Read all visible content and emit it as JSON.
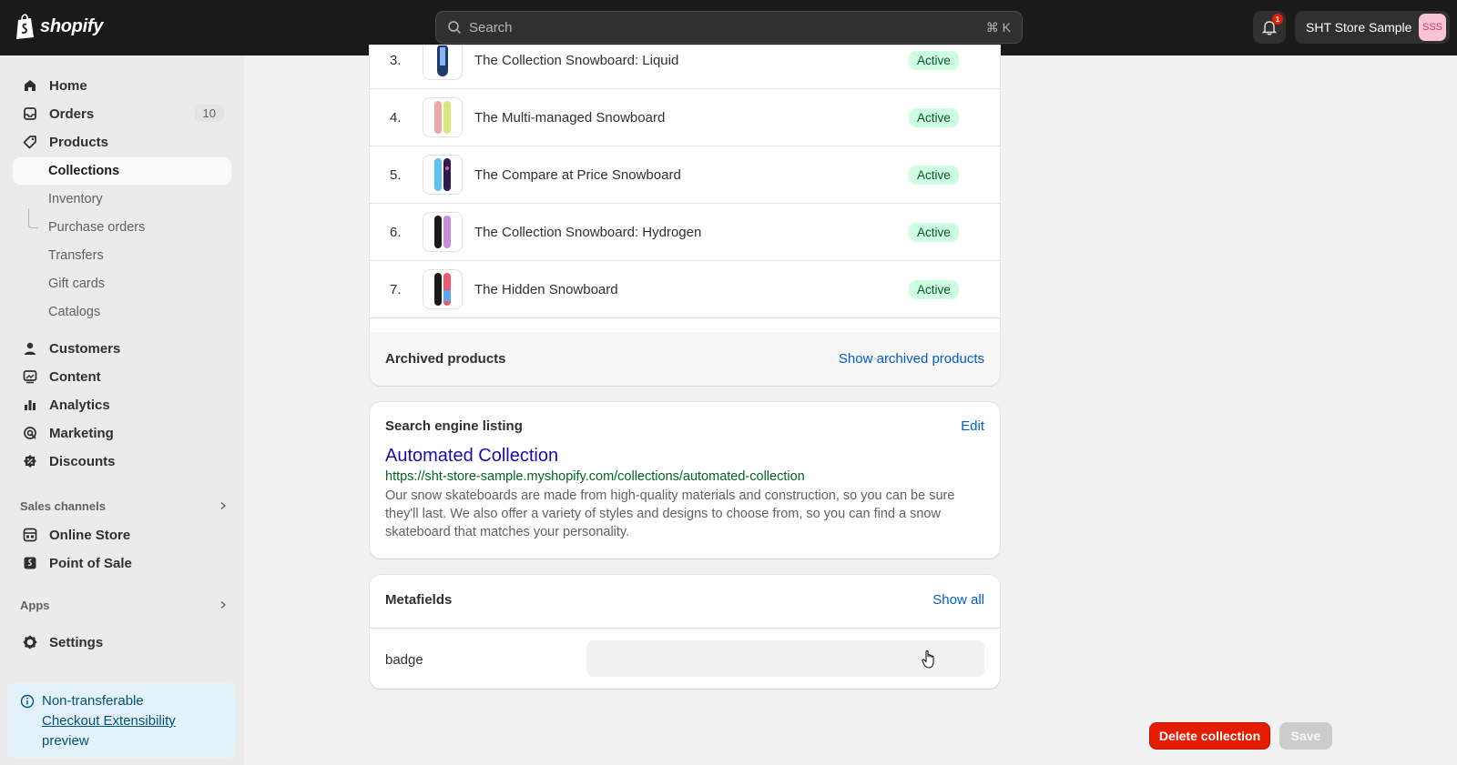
{
  "topbar": {
    "logo_text": "shopify",
    "search_placeholder": "Search",
    "search_shortcut": "⌘ K",
    "notification_count": "1",
    "store_name": "SHT Store Sample",
    "avatar_initials": "SSS"
  },
  "sidebar": {
    "items": [
      {
        "label": "Home",
        "icon": "home-icon"
      },
      {
        "label": "Orders",
        "icon": "inbox-icon",
        "count": "10"
      },
      {
        "label": "Products",
        "icon": "tag-icon"
      },
      {
        "label": "Collections"
      },
      {
        "label": "Inventory"
      },
      {
        "label": "Purchase orders"
      },
      {
        "label": "Transfers"
      },
      {
        "label": "Gift cards"
      },
      {
        "label": "Catalogs"
      },
      {
        "label": "Customers",
        "icon": "person-icon"
      },
      {
        "label": "Content",
        "icon": "content-icon"
      },
      {
        "label": "Analytics",
        "icon": "bar-chart-icon"
      },
      {
        "label": "Marketing",
        "icon": "target-icon"
      },
      {
        "label": "Discounts",
        "icon": "discount-icon"
      },
      {
        "label": "Online Store",
        "icon": "store-icon"
      },
      {
        "label": "Point of Sale",
        "icon": "pos-icon"
      },
      {
        "label": "Settings",
        "icon": "gear-icon"
      }
    ],
    "sales_channels_label": "Sales channels",
    "apps_label": "Apps",
    "notice": {
      "line1": "Non-transferable",
      "link": "Checkout Extensibility",
      "line3": "preview"
    }
  },
  "products": {
    "rows": [
      {
        "num": "3.",
        "title": "The Collection Snowboard: Liquid",
        "status": "Active"
      },
      {
        "num": "4.",
        "title": "The Multi-managed Snowboard",
        "status": "Active"
      },
      {
        "num": "5.",
        "title": "The Compare at Price Snowboard",
        "status": "Active"
      },
      {
        "num": "6.",
        "title": "The Collection Snowboard: Hydrogen",
        "status": "Active"
      },
      {
        "num": "7.",
        "title": "The Hidden Snowboard",
        "status": "Active"
      }
    ],
    "archived_title": "Archived products",
    "archived_link": "Show archived products"
  },
  "seo": {
    "title": "Search engine listing",
    "edit": "Edit",
    "page_title": "Automated Collection",
    "url": "https://sht-store-sample.myshopify.com/collections/automated-collection",
    "description": "Our snow skateboards are made from high-quality materials and construction, so you can be sure they'll last. We also offer a variety of styles and designs to choose from, so you can find a snow skateboard that matches your personality."
  },
  "metafields": {
    "title": "Metafields",
    "show_all": "Show all",
    "field_label": "badge",
    "field_value": ""
  },
  "actions": {
    "delete": "Delete collection",
    "save": "Save"
  },
  "colors": {
    "topbar": "#1a1a1a",
    "link": "#005bd3",
    "active_badge_bg": "#cdfee1",
    "danger": "#e51c00"
  }
}
